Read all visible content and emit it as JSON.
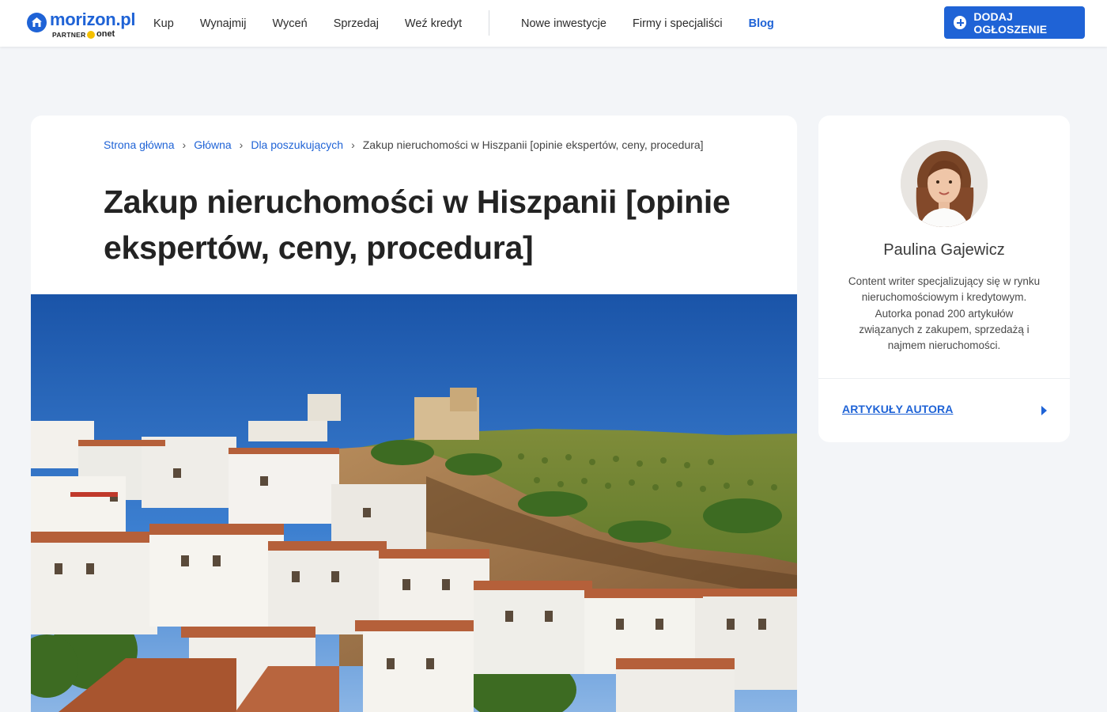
{
  "header": {
    "logo": {
      "name": "morizon.pl",
      "partner": "PARTNER",
      "partner_brand": "onet"
    },
    "nav_left": [
      "Kup",
      "Wynajmij",
      "Wyceń",
      "Sprzedaj",
      "Weź kredyt"
    ],
    "nav_right": [
      "Nowe inwestycje",
      "Firmy i specjaliści",
      "Blog"
    ],
    "active_nav": "Blog",
    "add_button": "DODAJ OGŁOSZENIE"
  },
  "article": {
    "breadcrumb": [
      "Strona główna",
      "Główna",
      "Dla poszukujących"
    ],
    "breadcrumb_current": "Zakup nieruchomości w Hiszpanii [opinie ekspertów, ceny, procedura]",
    "title": "Zakup nieruchomości w Hiszpanii [opinie ekspertów, ceny, procedura]"
  },
  "author": {
    "name": "Paulina Gajewicz",
    "bio": "Content writer specjalizujący się w rynku nieruchomościowym i kredytowym. Autorka ponad 200 artykułów związanych z zakupem, sprzedażą i najmem nieruchomości.",
    "link": "ARTYKUŁY AUTORA"
  },
  "colors": {
    "brand": "#1f63d6",
    "background": "#f3f5f8",
    "text": "#232323"
  }
}
